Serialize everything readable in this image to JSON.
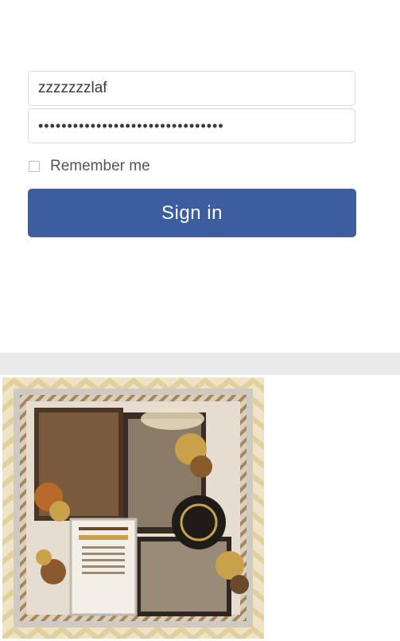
{
  "login": {
    "username_value": "zzzzzzzlaf",
    "password_value": "••••••••••••••••••••••••••••••••",
    "remember_label": "Remember me",
    "signin_label": "Sign in"
  },
  "scrapbook": {
    "image_name": "scrapbook-layout-image",
    "colors": {
      "gold": "#c9a14a",
      "brown": "#6b4a2b",
      "cream": "#efe3c6",
      "gray": "#bfbab0"
    }
  }
}
